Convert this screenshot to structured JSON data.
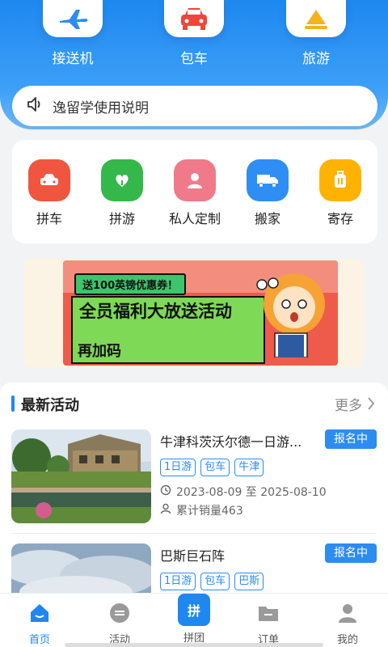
{
  "top_nav": [
    {
      "label": "接送机",
      "icon": "airplane-icon"
    },
    {
      "label": "包车",
      "icon": "car-icon"
    },
    {
      "label": "旅游",
      "icon": "mountain-icon"
    }
  ],
  "notice": {
    "text": "逸留学使用说明",
    "icon": "speaker-icon"
  },
  "services": [
    {
      "label": "拼车",
      "icon": "carpool-icon",
      "color": "#f0553f"
    },
    {
      "label": "拼游",
      "icon": "heart-leaf-icon",
      "color": "#35b84a"
    },
    {
      "label": "私人定制",
      "icon": "person-icon",
      "color": "#f07a8a"
    },
    {
      "label": "搬家",
      "icon": "truck-icon",
      "color": "#2f8ef4"
    },
    {
      "label": "寄存",
      "icon": "luggage-icon",
      "color": "#ffb300"
    }
  ],
  "banner": {
    "coupon": "送100英镑优惠券！",
    "headline": "全员福利大放送活动",
    "code": "再加码"
  },
  "activities": {
    "title": "最新活动",
    "more": "更多",
    "items": [
      {
        "title": "牛津科茨沃尔德一日游...",
        "status": "报名中",
        "tags": [
          "1日游",
          "包车",
          "牛津"
        ],
        "date": "2023-08-09 至 2025-08-10",
        "sales": "累计销量463"
      },
      {
        "title": "巴斯巨石阵",
        "status": "报名中",
        "tags": [
          "1日游",
          "包车",
          "巴斯"
        ]
      }
    ]
  },
  "tabbar": [
    {
      "label": "首页",
      "icon": "home-icon",
      "active": true
    },
    {
      "label": "活动",
      "icon": "activity-icon"
    },
    {
      "label": "拼团",
      "icon": "group-buy-icon",
      "glyph": "拼"
    },
    {
      "label": "订单",
      "icon": "order-folder-icon"
    },
    {
      "label": "我的",
      "icon": "profile-icon"
    }
  ],
  "colors": {
    "primary": "#1e88f0",
    "accent_blue": "#2d8cf0"
  }
}
